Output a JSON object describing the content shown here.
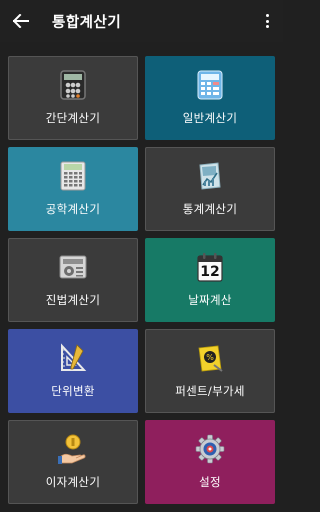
{
  "app_bar": {
    "title": "통합계산기",
    "back_icon": "arrow-left-icon",
    "menu_icon": "more-vert-icon"
  },
  "tiles": [
    {
      "label": "간단계산기",
      "icon": "calculator-dark-icon",
      "bg": "#3b3b3b"
    },
    {
      "label": "일반계산기",
      "icon": "calculator-blue-icon",
      "bg": "#0e5f78"
    },
    {
      "label": "공학계산기",
      "icon": "scientific-calculator-icon",
      "bg": "#2b87a0"
    },
    {
      "label": "통계계산기",
      "icon": "statistics-icon",
      "bg": "#3b3b3b"
    },
    {
      "label": "진법계산기",
      "icon": "base-converter-icon",
      "bg": "#3b3b3b"
    },
    {
      "label": "날짜계산",
      "icon": "calendar-icon",
      "calendar_number": "12",
      "bg": "#177a66"
    },
    {
      "label": "단위변환",
      "icon": "ruler-icon",
      "bg": "#3c4fa3"
    },
    {
      "label": "퍼센트/부가세",
      "icon": "percent-note-icon",
      "bg": "#3b3b3b"
    },
    {
      "label": "이자계산기",
      "icon": "coin-hand-icon",
      "bg": "#3b3b3b"
    },
    {
      "label": "설정",
      "icon": "settings-gear-icon",
      "bg": "#8f1f5d"
    }
  ]
}
